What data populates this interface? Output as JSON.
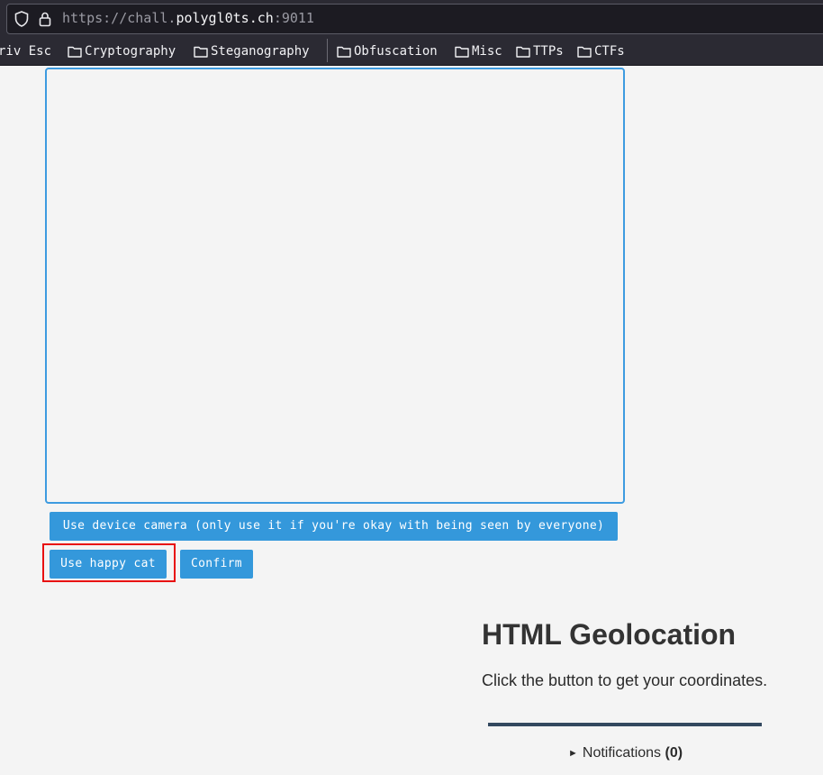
{
  "browser": {
    "url": {
      "scheme": "https://",
      "subdomain": "chall.",
      "host": "polygl0ts.ch",
      "port": ":9011"
    },
    "bookmarks": [
      {
        "label": "riv Esc",
        "folder": false
      },
      {
        "label": "Cryptography",
        "folder": true
      },
      {
        "label": "Steganography",
        "folder": true
      },
      {
        "label": "Obfuscation",
        "folder": true
      },
      {
        "label": "Misc",
        "folder": true
      },
      {
        "label": "TTPs",
        "folder": true
      },
      {
        "label": "CTFs",
        "folder": true
      }
    ]
  },
  "page": {
    "buttons": {
      "camera": "Use device camera (only use it if you're okay with being seen by everyone)",
      "happy_cat": "Use happy cat",
      "confirm": "Confirm"
    },
    "geolocation": {
      "title": "HTML Geolocation",
      "description": "Click the button to get your coordinates."
    },
    "notifications": {
      "label": "Notifications",
      "count": "(0)"
    }
  },
  "colors": {
    "button": "#3498db",
    "highlight": "#e81010",
    "page_bg": "#f4f4f4",
    "chrome_bg": "#2b2a33"
  }
}
